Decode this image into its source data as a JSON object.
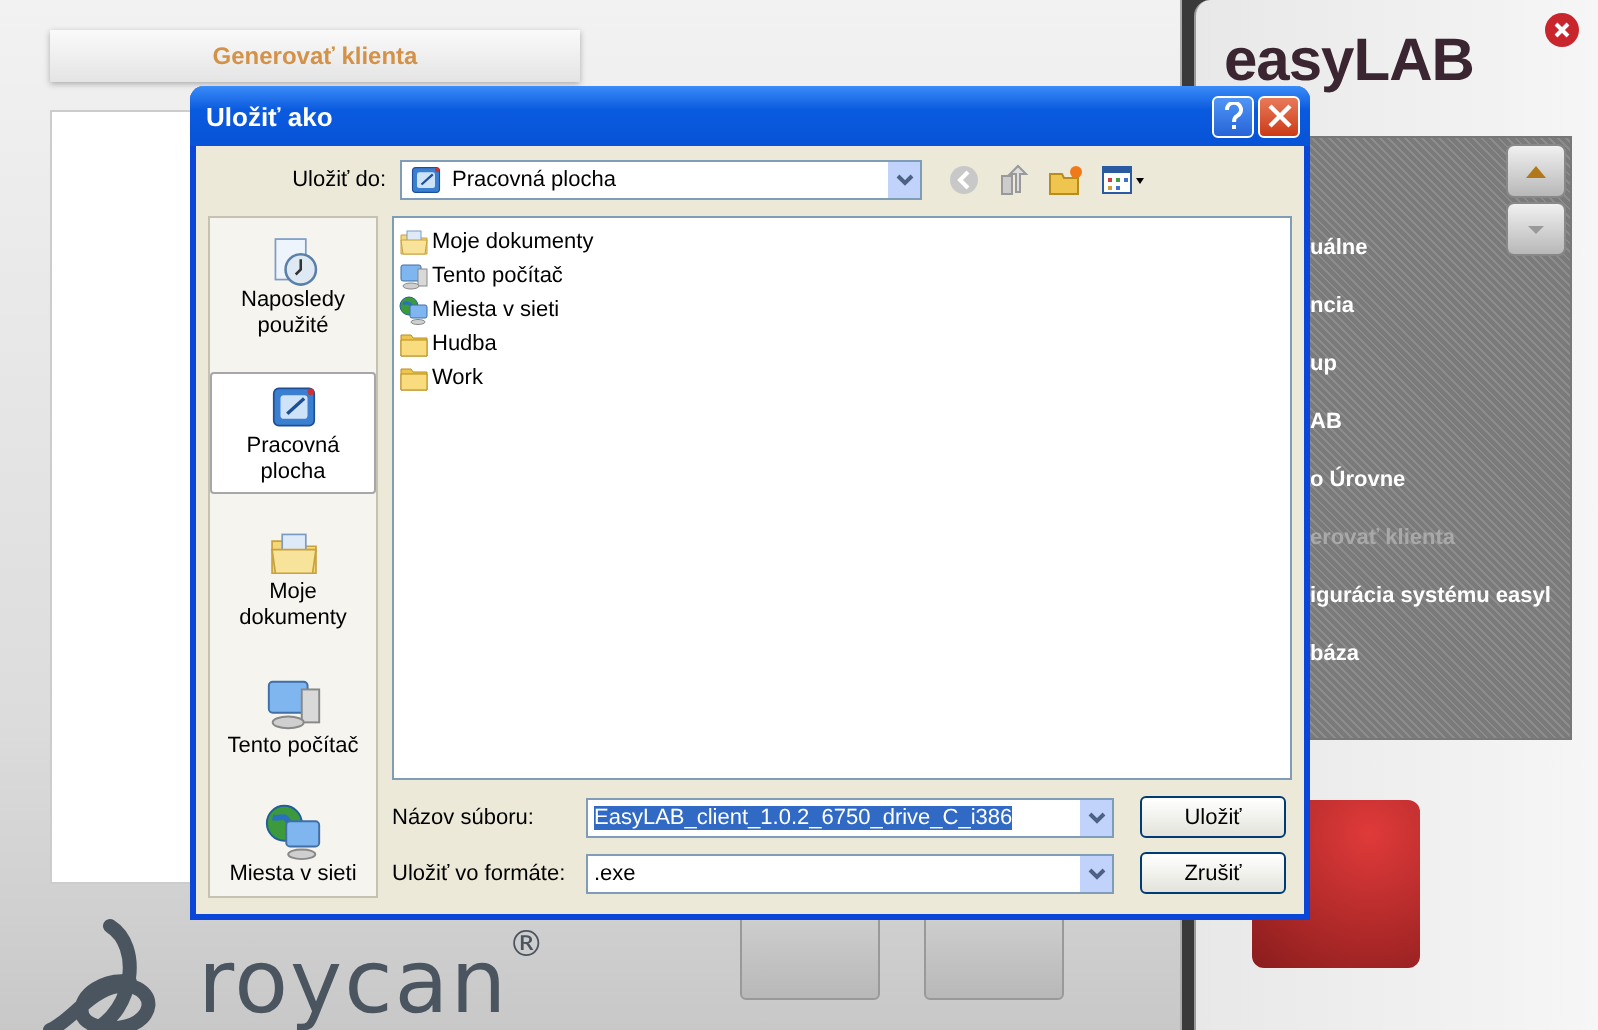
{
  "background_app": {
    "header_tab": "Generovať klienta",
    "logo": "roycan$^{®}$"
  },
  "side_panel": {
    "logo": "easyLAB",
    "menu_items": [
      {
        "label": "uálne",
        "disabled": false
      },
      {
        "label": "ncia",
        "disabled": false
      },
      {
        "label": "up",
        "disabled": false
      },
      {
        "label": "AB",
        "disabled": false
      },
      {
        "label": "o Úrovne",
        "disabled": false
      },
      {
        "label": "erovať klienta",
        "disabled": true
      },
      {
        "label": "igurácia systému easyl",
        "disabled": false
      },
      {
        "label": "báza",
        "disabled": false
      }
    ]
  },
  "dialog": {
    "title": "Uložiť ako",
    "save_in": {
      "label": "Uložiť do:",
      "value": "Pracovná plocha"
    },
    "places": [
      {
        "label": "Naposledy použité",
        "kind": "recent",
        "selected": false
      },
      {
        "label": "Pracovná plocha",
        "kind": "desktop",
        "selected": true
      },
      {
        "label": "Moje dokumenty",
        "kind": "documents",
        "selected": false
      },
      {
        "label": "Tento počítač",
        "kind": "computer",
        "selected": false
      },
      {
        "label": "Miesta v sieti",
        "kind": "network",
        "selected": false
      }
    ],
    "files": [
      {
        "name": "Moje dokumenty",
        "kind": "documents"
      },
      {
        "name": "Tento počítač",
        "kind": "computer"
      },
      {
        "name": "Miesta v sieti",
        "kind": "network"
      },
      {
        "name": "Hudba",
        "kind": "folder"
      },
      {
        "name": "Work",
        "kind": "folder"
      }
    ],
    "file_name": {
      "label": "Názov súboru:",
      "value": "EasyLAB_client_1.0.2_6750_drive_C_i386",
      "selected": true
    },
    "file_type": {
      "label": "Uložiť vo formáte:",
      "value": ".exe"
    },
    "buttons": [
      "Uložiť",
      "Zrušiť"
    ]
  }
}
